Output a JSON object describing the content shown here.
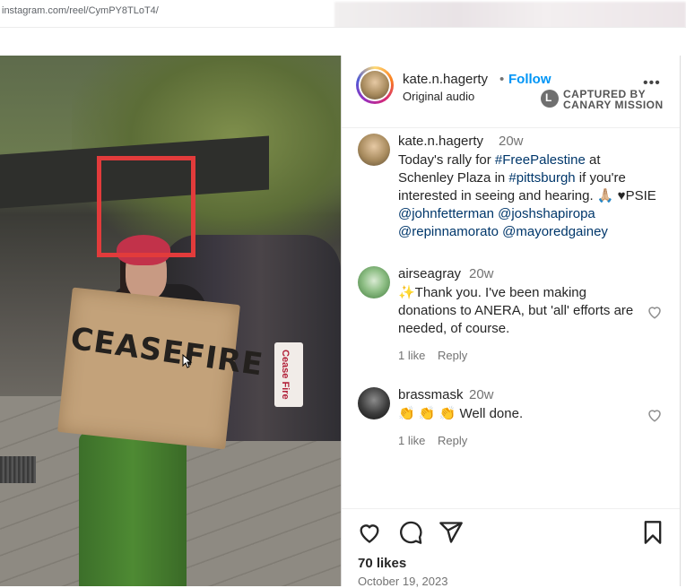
{
  "browser": {
    "url": "instagram.com/reel/CymPY8TLoT4/"
  },
  "video": {
    "sign_text": "CEASEFIRE",
    "small_sign_text": "Cease Fire"
  },
  "post": {
    "author": "kate.n.hagerty",
    "separator": "•",
    "follow_label": "Follow",
    "audio": "Original audio",
    "more_label": "•••",
    "watermark_line1": "CAPTURED BY",
    "watermark_line2": "CANARY MISSION"
  },
  "caption": {
    "user": "kate.n.hagerty",
    "time": "20w",
    "text_1": "Today's rally for ",
    "hashtag_1": "#FreePalestine",
    "text_2": " at Schenley Plaza in ",
    "hashtag_2": "#pittsburgh",
    "text_3": " if you're interested in seeing and hearing. 🙏🏼 ♥PSIE",
    "mention_1": "@johnfetterman",
    "mention_2": "@joshshapiropa",
    "mention_3": "@repinnamorato",
    "mention_4": "@mayoredgainey"
  },
  "comments": [
    {
      "user": "airseagray",
      "time": "20w",
      "text": "✨Thank you. I've been making donations to ANERA, but 'all' efforts are needed, of course.",
      "likes": "1 like",
      "reply": "Reply"
    },
    {
      "user": "brassmask",
      "time": "20w",
      "text": "👏 👏 👏 Well done.",
      "likes": "1 like",
      "reply": "Reply"
    }
  ],
  "actions": {
    "likes": "70 likes",
    "date": "October 19, 2023"
  },
  "icons": [
    "heart-icon",
    "comment-icon",
    "share-icon",
    "bookmark-icon",
    "canary-logo-icon",
    "cursor-icon"
  ],
  "colors": {
    "follow": "#0095f6",
    "highlight_box": "#e23b3b",
    "tag": "#00376b"
  }
}
